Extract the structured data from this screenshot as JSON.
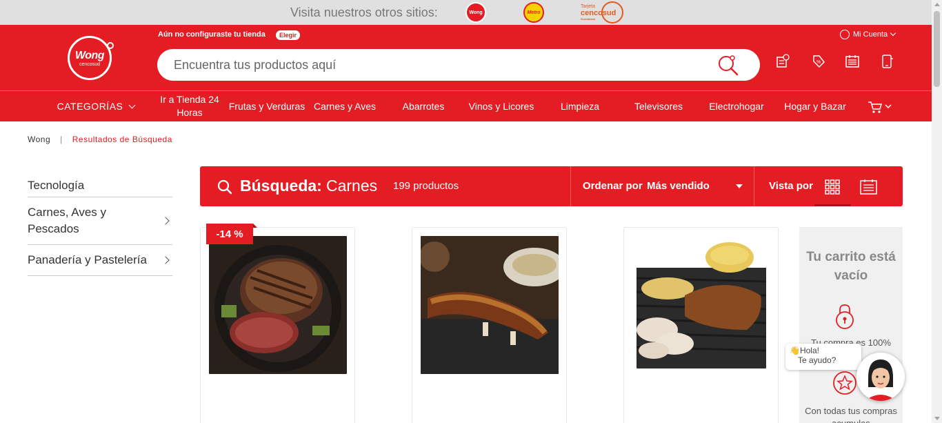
{
  "top_strip": {
    "visit_text": "Visita nuestros otros sitios:",
    "sites": [
      {
        "name": "Wong",
        "label": "Wong"
      },
      {
        "name": "Metro",
        "label": "Metro"
      },
      {
        "name": "Tarjeta Cencosud",
        "label_line1": "Tarjeta",
        "label_line2": "cencosud",
        "label_line3": "Scotiabank"
      }
    ]
  },
  "header": {
    "brand_name": "Wong",
    "brand_sub": "cencosud",
    "store_message": "Aún no configuraste tu tienda",
    "store_button": "Elegir",
    "account_label": "Mi Cuenta",
    "search_placeholder": "Encuentra tus productos aquí",
    "icons": [
      "receipt-icon",
      "tag-icon",
      "list-icon",
      "mobile-icon"
    ]
  },
  "nav": {
    "categories_label": "CATEGORÍAS",
    "items": [
      "Ir a Tienda 24 Horas",
      "Frutas y Verduras",
      "Carnes y Aves",
      "Abarrotes",
      "Vinos y Licores",
      "Limpieza",
      "Televisores",
      "Electrohogar",
      "Hogar y Bazar"
    ]
  },
  "breadcrumb": {
    "home": "Wong",
    "separator": "|",
    "current": "Resultados de Búsqueda"
  },
  "sidebar": {
    "items": [
      {
        "label": "Tecnología"
      },
      {
        "label": "Carnes, Aves y Pescados"
      },
      {
        "label": "Panadería y Pastelería"
      }
    ]
  },
  "results": {
    "search_label": "Búsqueda:",
    "search_term": "Carnes",
    "count": "199 productos",
    "order_label": "Ordenar por",
    "order_value": "Más vendido",
    "view_label": "Vista por"
  },
  "products": [
    {
      "badge": "-14 %"
    },
    {
      "badge": ""
    },
    {
      "badge": ""
    }
  ],
  "cart": {
    "title": "Tu carrito está vacío",
    "text1": "Tu compra es 100%",
    "text2": "Con todas tus compras acumulas"
  },
  "chat": {
    "line1": "👋Hola!",
    "line2": "Te ayudo?"
  },
  "colors": {
    "brand_red": "#e31d23",
    "dark_red": "#a8141a",
    "gray_text": "#888888"
  }
}
